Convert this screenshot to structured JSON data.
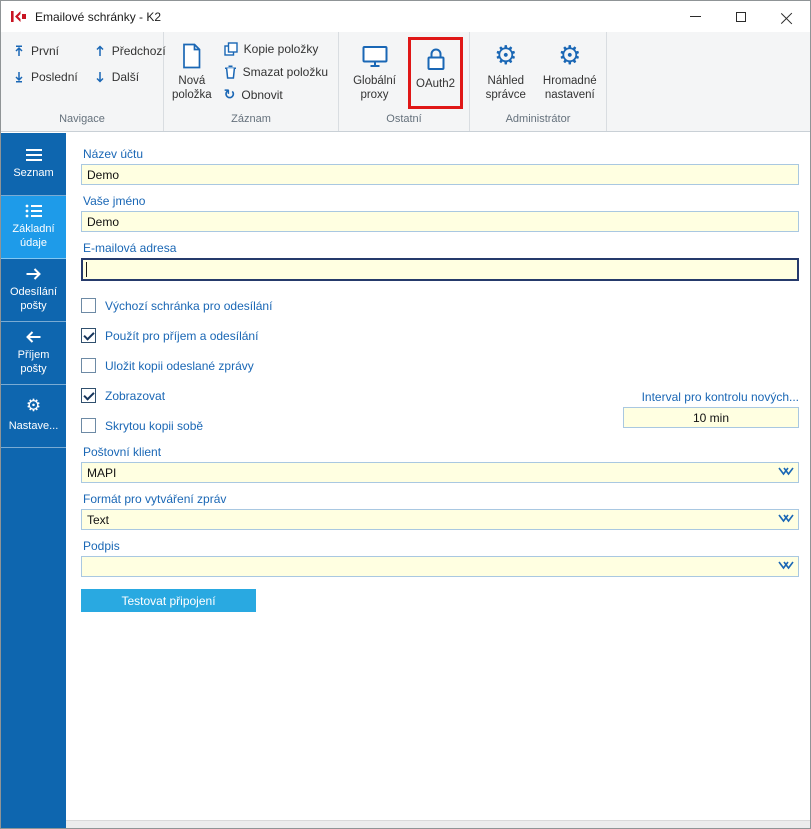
{
  "window": {
    "title": "Emailové schránky - K2"
  },
  "ribbon": {
    "navigace": {
      "label": "Navigace",
      "first": "První",
      "last": "Poslední",
      "prev": "Předchozí",
      "next": "Další"
    },
    "zaznam": {
      "label": "Záznam",
      "new": "Nová položka",
      "copy": "Kopie položky",
      "delete": "Smazat položku",
      "refresh": "Obnovit"
    },
    "ostatni": {
      "label": "Ostatní",
      "proxy": "Globální proxy",
      "oauth": "OAuth2"
    },
    "administrator": {
      "label": "Administrátor",
      "preview": "Náhled správce",
      "bulk": "Hromadné nastavení"
    }
  },
  "sidebar": {
    "items": [
      {
        "label": "Seznam"
      },
      {
        "label": "Základní údaje"
      },
      {
        "label": "Odesílání pošty"
      },
      {
        "label": "Příjem pošty"
      },
      {
        "label": "Nastave..."
      }
    ]
  },
  "form": {
    "nazev_uctu": {
      "label": "Název účtu",
      "value": "Demo"
    },
    "vase_jmeno": {
      "label": "Vaše jméno",
      "value": "Demo"
    },
    "email": {
      "label": "E-mailová adresa",
      "value": ""
    },
    "checkboxes": [
      {
        "label": "Výchozí schránka pro odesílání",
        "checked": "false"
      },
      {
        "label": "Použít pro příjem a odesílání",
        "checked": "true"
      },
      {
        "label": "Uložit kopii odeslané zprávy",
        "checked": "false"
      },
      {
        "label": "Zobrazovat",
        "checked": "true"
      },
      {
        "label": "Skrytou kopii sobě",
        "checked": "false"
      }
    ],
    "interval": {
      "label": "Interval pro kontrolu nových...",
      "value": "10 min"
    },
    "klient": {
      "label": "Poštovní klient",
      "value": "MAPI"
    },
    "format": {
      "label": "Formát pro vytváření zpráv",
      "value": "Text"
    },
    "podpis": {
      "label": "Podpis",
      "value": ""
    },
    "test_button": "Testovat připojení"
  },
  "colors": {
    "sidebar_bg": "#0e66af",
    "sidebar_selected": "#1e9be9",
    "label_blue": "#1a67b5",
    "input_bg": "#ffffe1",
    "highlight_red": "#e01717",
    "test_button_bg": "#29a9e1"
  }
}
